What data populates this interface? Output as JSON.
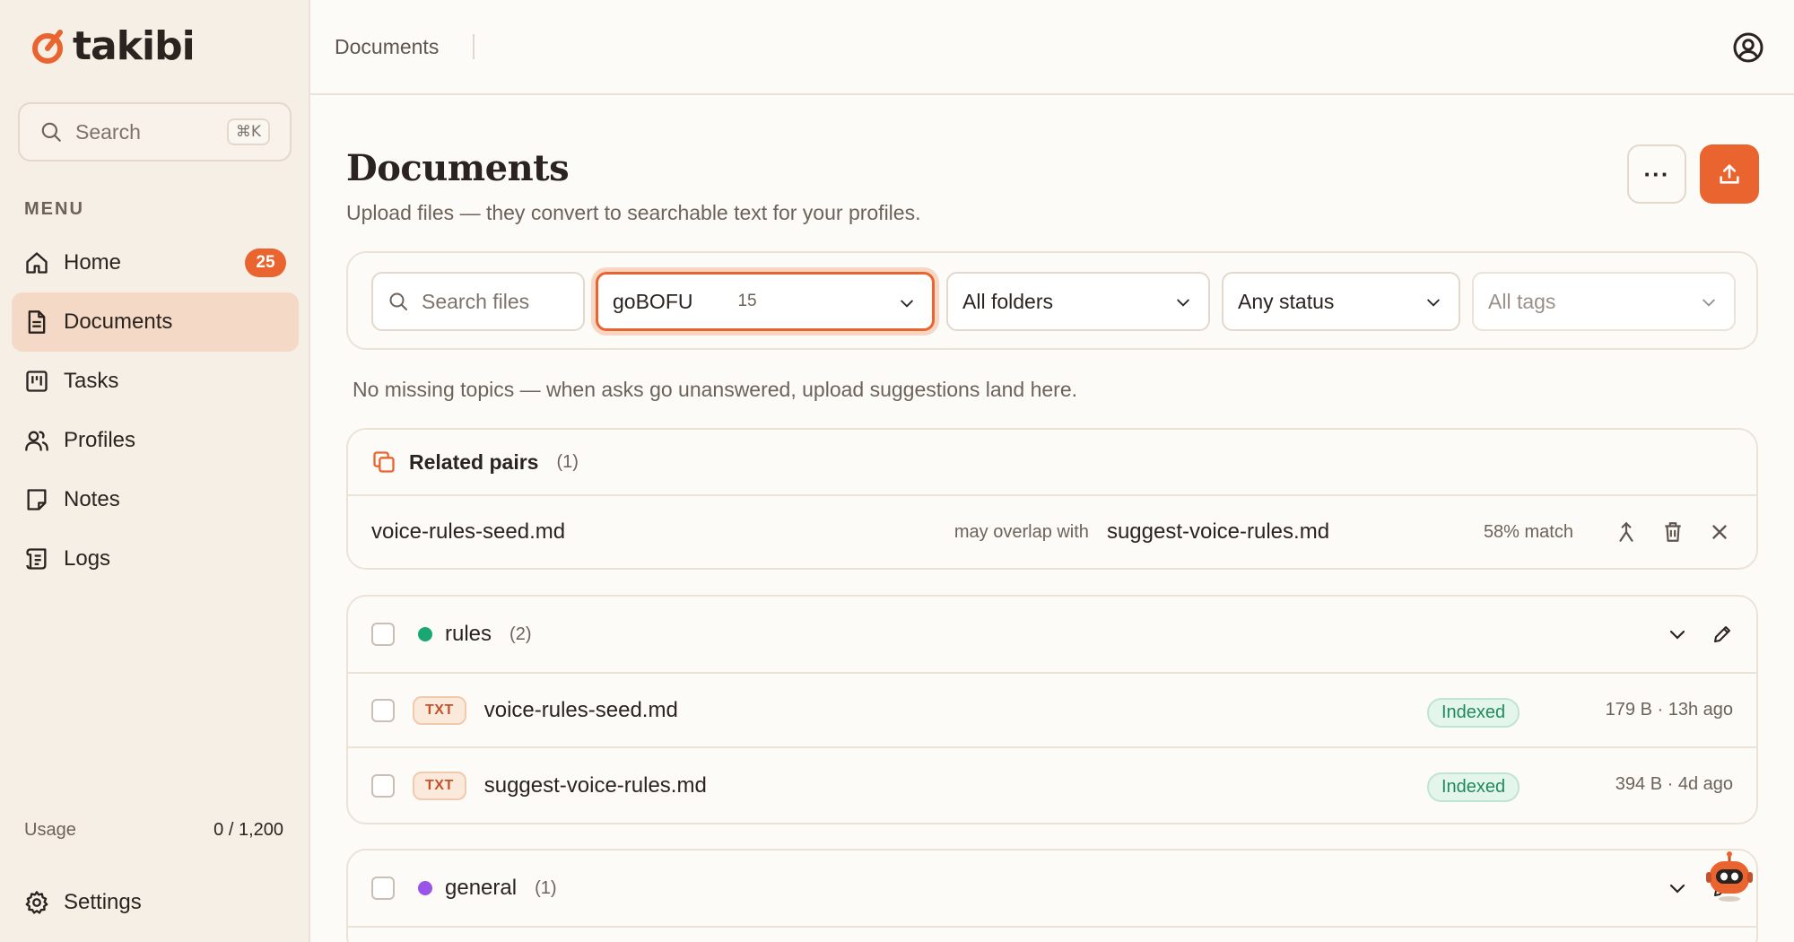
{
  "brand": {
    "name": "takibi",
    "accent": "#ea6430"
  },
  "sidebar": {
    "search_label": "Search",
    "search_shortcut": "⌘K",
    "menu_label": "MENU",
    "items": [
      {
        "label": "Home",
        "icon": "home-icon",
        "badge": "25"
      },
      {
        "label": "Documents",
        "icon": "document-icon",
        "active": true
      },
      {
        "label": "Tasks",
        "icon": "kanban-icon"
      },
      {
        "label": "Profiles",
        "icon": "users-icon"
      },
      {
        "label": "Notes",
        "icon": "note-icon"
      },
      {
        "label": "Logs",
        "icon": "logs-icon"
      }
    ],
    "usage_label": "Usage",
    "usage_value": "0 / 1,200",
    "settings_label": "Settings"
  },
  "topbar": {
    "breadcrumb": "Documents"
  },
  "page": {
    "title": "Documents",
    "subtitle": "Upload files — they convert to searchable text for your profiles.",
    "more_label": "···"
  },
  "filters": {
    "search_placeholder": "Search files",
    "profile": {
      "value": "goBOFU",
      "count": "15"
    },
    "folders": "All folders",
    "status": "Any status",
    "tags": "All tags"
  },
  "notice": "No missing topics — when asks go unanswered, upload suggestions land here.",
  "related": {
    "title": "Related pairs",
    "count": "(1)",
    "pairs": [
      {
        "left": "voice-rules-seed.md",
        "overlap_label": "may overlap with",
        "right": "suggest-voice-rules.md",
        "match": "58% match"
      }
    ]
  },
  "groups": [
    {
      "name": "rules",
      "count": "(2)",
      "color": "#1aa772",
      "docs": [
        {
          "type": "TXT",
          "name": "voice-rules-seed.md",
          "status": "Indexed",
          "meta": "179 B · 13h ago"
        },
        {
          "type": "TXT",
          "name": "suggest-voice-rules.md",
          "status": "Indexed",
          "meta": "394 B · 4d ago"
        }
      ]
    },
    {
      "name": "general",
      "count": "(1)",
      "color": "#9a55e6"
    }
  ]
}
